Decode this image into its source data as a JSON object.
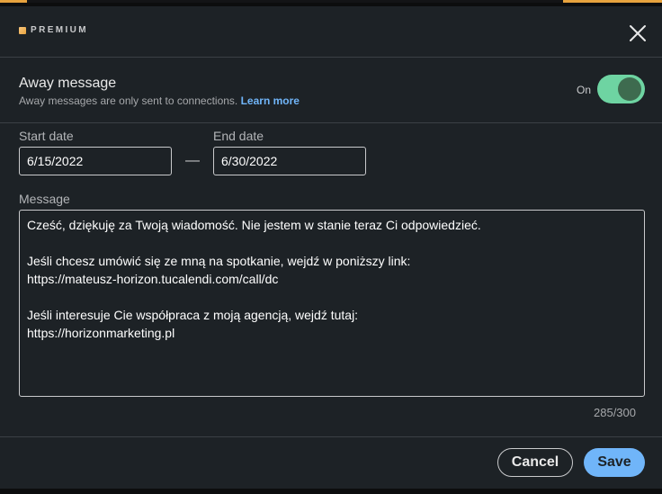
{
  "premium": {
    "label": "PREMIUM"
  },
  "away": {
    "title": "Away message",
    "subtitle": "Away messages are only sent to connections.",
    "learn_more": "Learn more",
    "toggle_state": "On"
  },
  "dates": {
    "start_label": "Start date",
    "start_value": "6/15/2022",
    "separator": "—",
    "end_label": "End date",
    "end_value": "6/30/2022"
  },
  "message": {
    "label": "Message",
    "lines": [
      "Cześć, dziękuję za Twoją wiadomość. Nie jestem w stanie teraz Ci odpowiedzieć.",
      "",
      "Jeśli chcesz umówić się ze mną na spotkanie, wejdź w poniższy link:",
      "https://mateusz-horizon.tucalendi.com/call/dc",
      "",
      "Jeśli interesuje Cie współpraca z moją agencją, wejdź tutaj:",
      "https://horizonmarketing.pl"
    ],
    "counter": "285/300"
  },
  "footer": {
    "cancel_label": "Cancel",
    "save_label": "Save"
  },
  "colors": {
    "accent_blue": "#70b5f9",
    "toggle_green": "#6ed4a2",
    "premium_gold": "#e7a33e",
    "background": "#1d2226"
  }
}
